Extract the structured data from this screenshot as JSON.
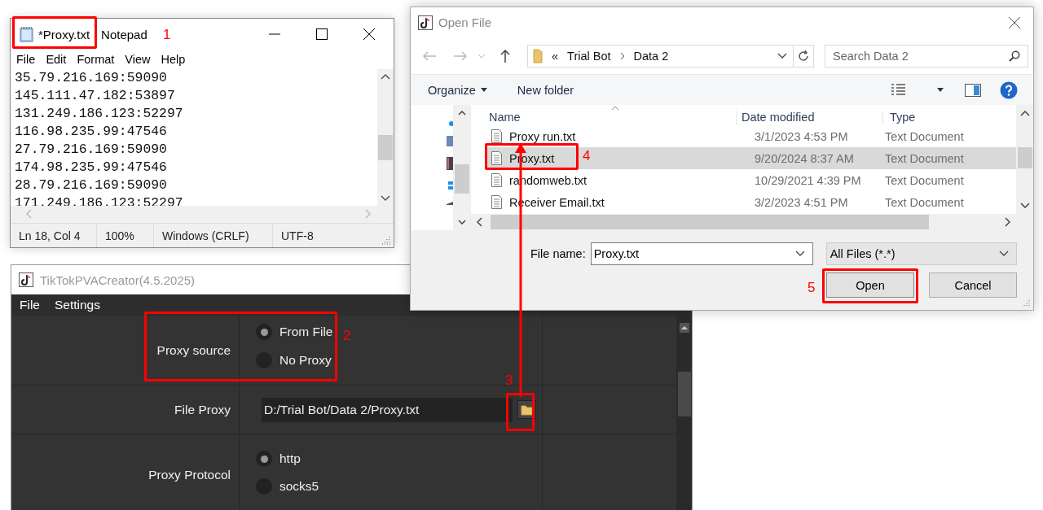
{
  "notepad": {
    "title": "*Proxy.txt",
    "app_name": "Notepad",
    "menu": [
      "File",
      "Edit",
      "Format",
      "View",
      "Help"
    ],
    "lines": [
      "35.79.216.169:59090",
      "145.111.47.182:53897",
      "131.249.186.123:52297",
      "116.98.235.99:47546",
      "27.79.216.169:59090",
      "174.98.235.99:47546",
      "28.79.216.169:59090",
      "171.249.186.123:52297"
    ],
    "status_bar": [
      "Ln 18, Col 4",
      "100%",
      "Windows (CRLF)",
      "UTF-8"
    ]
  },
  "app": {
    "title": "TikTokPVACreator(4.5.2025)",
    "menu": [
      "File",
      "Settings"
    ],
    "settings": [
      {
        "kind": "radio",
        "label": "Proxy source",
        "options": [
          {
            "label": "From File",
            "selected": true
          },
          {
            "label": "No Proxy",
            "selected": false
          }
        ]
      },
      {
        "kind": "file",
        "label": "File Proxy",
        "value": "D:/Trial Bot/Data 2/Proxy.txt"
      },
      {
        "kind": "radio",
        "label": "Proxy Protocol",
        "options": [
          {
            "label": "http",
            "selected": true
          },
          {
            "label": "socks5",
            "selected": false
          }
        ]
      }
    ]
  },
  "open_file_dialog": {
    "title": "Open File",
    "breadcrumb": [
      "«",
      "Trial Bot",
      "Data 2"
    ],
    "search": {
      "placeholder": "Search Data 2"
    },
    "toolbar": [
      "Organize",
      "New folder"
    ],
    "columns": [
      "Name",
      "Date modified",
      "Type"
    ],
    "files": [
      {
        "name": "Proxy run.txt",
        "date_modified": "3/1/2023 4:53 PM",
        "type": "Text Document",
        "selected": false
      },
      {
        "name": "Proxy.txt",
        "date_modified": "9/20/2024 8:37 AM",
        "type": "Text Document",
        "selected": true
      },
      {
        "name": "randomweb.txt",
        "date_modified": "10/29/2021 4:39 PM",
        "type": "Text Document",
        "selected": false
      },
      {
        "name": "Receiver Email.txt",
        "date_modified": "3/2/2023 4:51 PM",
        "type": "Text Document",
        "selected": false
      }
    ],
    "file_name_label": "File name:",
    "file_name": "Proxy.txt",
    "file_type": "All Files (*.*)",
    "buttons": [
      "Open",
      "Cancel"
    ]
  },
  "annotations": [
    {
      "number": "1"
    },
    {
      "number": "2"
    },
    {
      "number": "3"
    },
    {
      "number": "4"
    },
    {
      "number": "5"
    }
  ]
}
